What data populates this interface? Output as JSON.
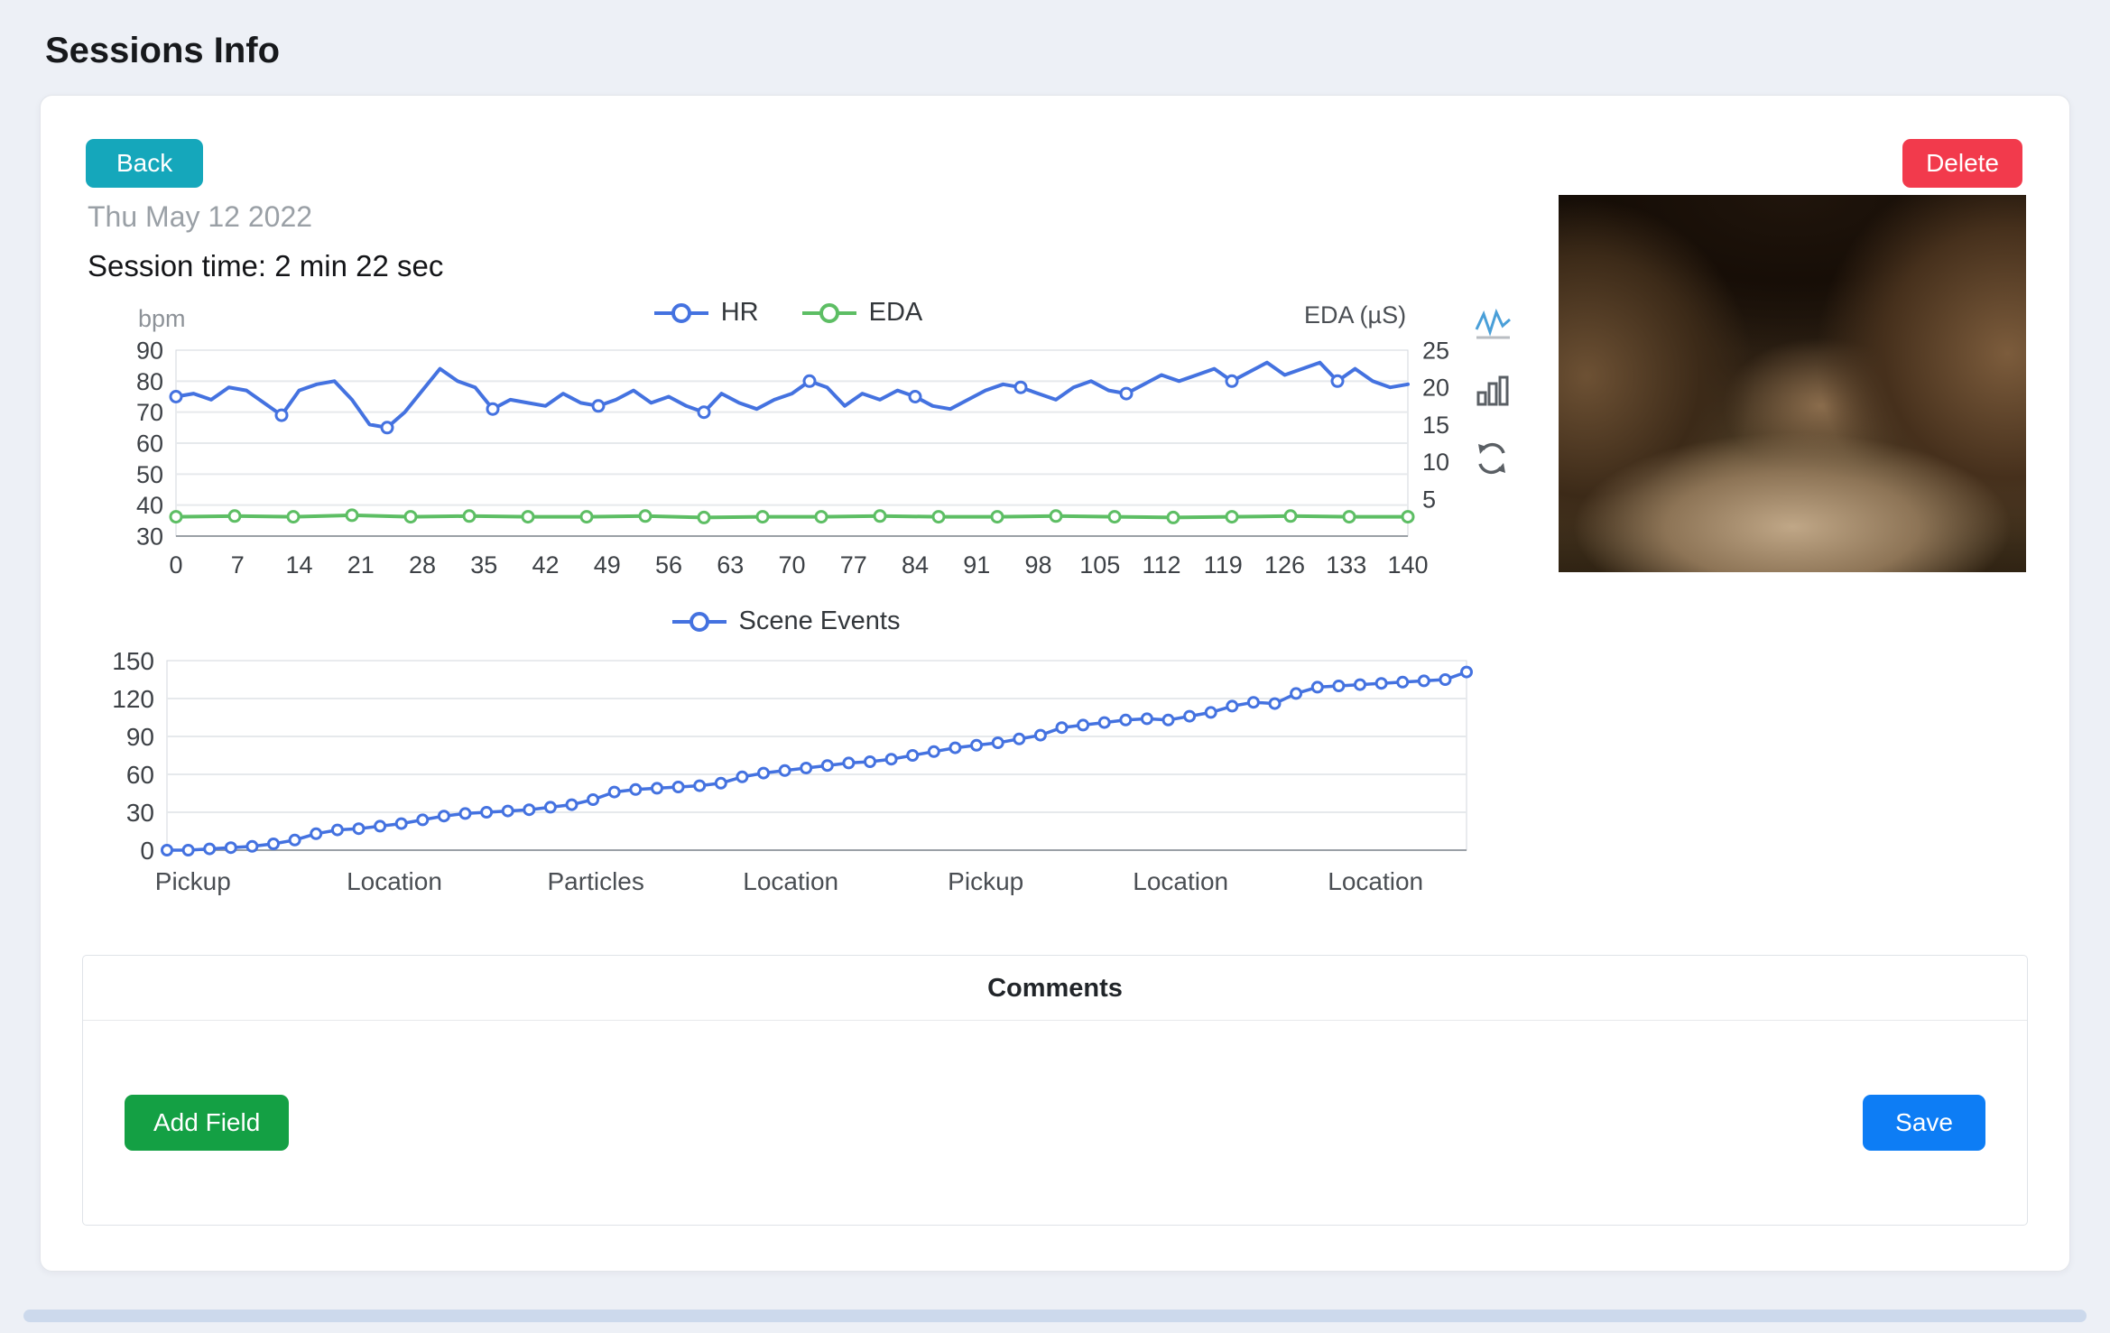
{
  "page": {
    "title": "Sessions Info"
  },
  "toolbar": {
    "back_label": "Back",
    "delete_label": "Delete"
  },
  "session": {
    "date": "Thu May 12 2022",
    "time_label": "Session time: 2 min 22 sec"
  },
  "comments": {
    "title": "Comments",
    "add_field_label": "Add Field",
    "save_label": "Save"
  },
  "colors": {
    "back_button": "#15a7bb",
    "delete_button": "#f23a4c",
    "add_field_button": "#14a044",
    "save_button": "#0d7df5",
    "hr_line": "#4472e0",
    "eda_line": "#5dbe64",
    "scene_line": "#4472e0"
  },
  "chart_data": [
    {
      "type": "line",
      "name": "hr-eda-over-time",
      "y_left": {
        "label": "bpm",
        "ticks": [
          30,
          40,
          50,
          60,
          70,
          80,
          90
        ],
        "range": [
          30,
          90
        ]
      },
      "y_right": {
        "label": "EDA (µS)",
        "ticks": [
          5,
          10,
          15,
          20,
          25
        ],
        "range": [
          0,
          25
        ]
      },
      "x_ticks": [
        0,
        7,
        14,
        21,
        28,
        35,
        42,
        49,
        56,
        63,
        70,
        77,
        84,
        91,
        98,
        105,
        112,
        119,
        126,
        133,
        140
      ],
      "x_max": 140,
      "legend": [
        {
          "name": "HR",
          "color": "#4472e0"
        },
        {
          "name": "EDA",
          "color": "#5dbe64"
        }
      ],
      "series": [
        {
          "name": "HR",
          "axis": "left",
          "color": "#4472e0",
          "width": 4,
          "marker_every": 6,
          "marker_r": 6,
          "values": [
            75,
            76,
            74,
            78,
            77,
            73,
            69,
            77,
            79,
            80,
            74,
            66,
            65,
            70,
            77,
            84,
            80,
            78,
            71,
            74,
            73,
            72,
            76,
            73,
            72,
            74,
            77,
            73,
            75,
            72,
            70,
            76,
            73,
            71,
            74,
            76,
            80,
            78,
            72,
            76,
            74,
            77,
            75,
            72,
            71,
            74,
            77,
            79,
            78,
            76,
            74,
            78,
            80,
            77,
            76,
            79,
            82,
            80,
            82,
            84,
            80,
            83,
            86,
            82,
            84,
            86,
            80,
            84,
            80,
            78,
            79
          ]
        },
        {
          "name": "EDA",
          "axis": "right",
          "color": "#5dbe64",
          "width": 4,
          "marker_every": 1,
          "marker_r": 6,
          "values": [
            2.6,
            2.7,
            2.6,
            2.8,
            2.6,
            2.7,
            2.6,
            2.6,
            2.7,
            2.5,
            2.6,
            2.6,
            2.7,
            2.6,
            2.6,
            2.7,
            2.6,
            2.5,
            2.6,
            2.7,
            2.6,
            2.6
          ]
        }
      ]
    },
    {
      "type": "line",
      "name": "scene-events-cumulative",
      "y_left": {
        "label": "",
        "ticks": [
          0,
          30,
          60,
          90,
          120,
          150
        ],
        "range": [
          0,
          150
        ]
      },
      "x_labels": [
        {
          "label": "Pickup",
          "pos": 0.02
        },
        {
          "label": "Location",
          "pos": 0.175
        },
        {
          "label": "Particles",
          "pos": 0.33
        },
        {
          "label": "Location",
          "pos": 0.48
        },
        {
          "label": "Pickup",
          "pos": 0.63
        },
        {
          "label": "Location",
          "pos": 0.78
        },
        {
          "label": "Location",
          "pos": 0.93
        }
      ],
      "legend": [
        {
          "name": "Scene Events",
          "color": "#4472e0"
        }
      ],
      "series": [
        {
          "name": "Scene Events",
          "axis": "left",
          "color": "#4472e0",
          "width": 3.5,
          "marker_every": 1,
          "marker_r": 5.5,
          "values": [
            0,
            0,
            1,
            2,
            3,
            5,
            8,
            13,
            16,
            17,
            19,
            21,
            24,
            27,
            29,
            30,
            31,
            32,
            34,
            36,
            40,
            46,
            48,
            49,
            50,
            51,
            53,
            58,
            61,
            63,
            65,
            67,
            69,
            70,
            72,
            75,
            78,
            81,
            83,
            85,
            88,
            91,
            97,
            99,
            101,
            103,
            104,
            103,
            106,
            109,
            114,
            117,
            116,
            124,
            129,
            130,
            131,
            132,
            133,
            134,
            135,
            141
          ]
        }
      ]
    }
  ]
}
